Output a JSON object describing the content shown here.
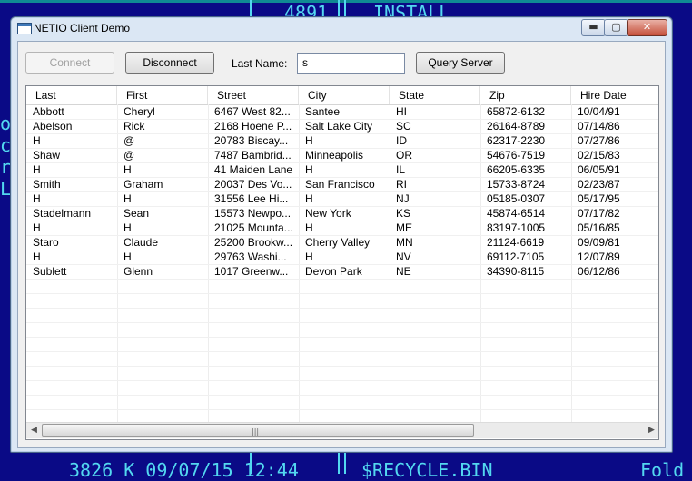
{
  "background": {
    "fragments": [
      "4891",
      "INSTALL",
      "3826 K 09/07/15 12:44",
      "$RECYCLE.BIN",
      "Fold",
      "or",
      "ct",
      "ry",
      "La"
    ]
  },
  "window": {
    "title": "NETIO Client Demo",
    "minimize_glyph": "▬",
    "maximize_glyph": "▢",
    "close_glyph": "✕"
  },
  "toolbar": {
    "connect_label": "Connect",
    "disconnect_label": "Disconnect",
    "lastname_label": "Last Name:",
    "lastname_value": "s",
    "query_label": "Query Server"
  },
  "table": {
    "columns": [
      "Last",
      "First",
      "Street",
      "City",
      "State",
      "Zip",
      "Hire Date"
    ],
    "rows": [
      [
        "Abbott",
        "Cheryl",
        "6467 West 82...",
        "Santee",
        "HI",
        "65872-6132",
        "10/04/91"
      ],
      [
        "Abelson",
        "Rick",
        "2168 Hoene P...",
        "Salt Lake City",
        "SC",
        "26164-8789",
        "07/14/86"
      ],
      [
        "H",
        "@",
        "20783 Biscay...",
        "H",
        "ID",
        "62317-2230",
        "07/27/86"
      ],
      [
        "Shaw",
        "@",
        "7487 Bambrid...",
        "Minneapolis",
        "OR",
        "54676-7519",
        "02/15/83"
      ],
      [
        "H",
        "H",
        "41 Maiden Lane",
        "H",
        "IL",
        "66205-6335",
        "06/05/91"
      ],
      [
        "Smith",
        "Graham",
        "20037 Des Vo...",
        "San Francisco",
        "RI",
        "15733-8724",
        "02/23/87"
      ],
      [
        "H",
        "H",
        "31556 Lee Hi...",
        "H",
        "NJ",
        "05185-0307",
        "05/17/95"
      ],
      [
        "Stadelmann",
        "Sean",
        "15573 Newpo...",
        "New York",
        "KS",
        "45874-6514",
        "07/17/82"
      ],
      [
        "H",
        "H",
        "21025 Mounta...",
        "H",
        "ME",
        "83197-1005",
        "05/16/85"
      ],
      [
        "Staro",
        "Claude",
        "25200 Brookw...",
        "Cherry Valley",
        "MN",
        "21124-6619",
        "09/09/81"
      ],
      [
        "H",
        "H",
        "29763 Washi...",
        "H",
        "NV",
        "69112-7105",
        "12/07/89"
      ],
      [
        "Sublett",
        "Glenn",
        "1017 Greenw...",
        "Devon Park",
        "NE",
        "34390-8115",
        "06/12/86"
      ]
    ],
    "scroll_left_glyph": "◀",
    "scroll_right_glyph": "▶",
    "thumb_grip_glyph": "|||"
  },
  "colors": {
    "desktop_bg": "#0a0a86",
    "console_text": "#53d8f0",
    "window_frame": "#dbe7f4",
    "close_button": "#c5503b"
  }
}
